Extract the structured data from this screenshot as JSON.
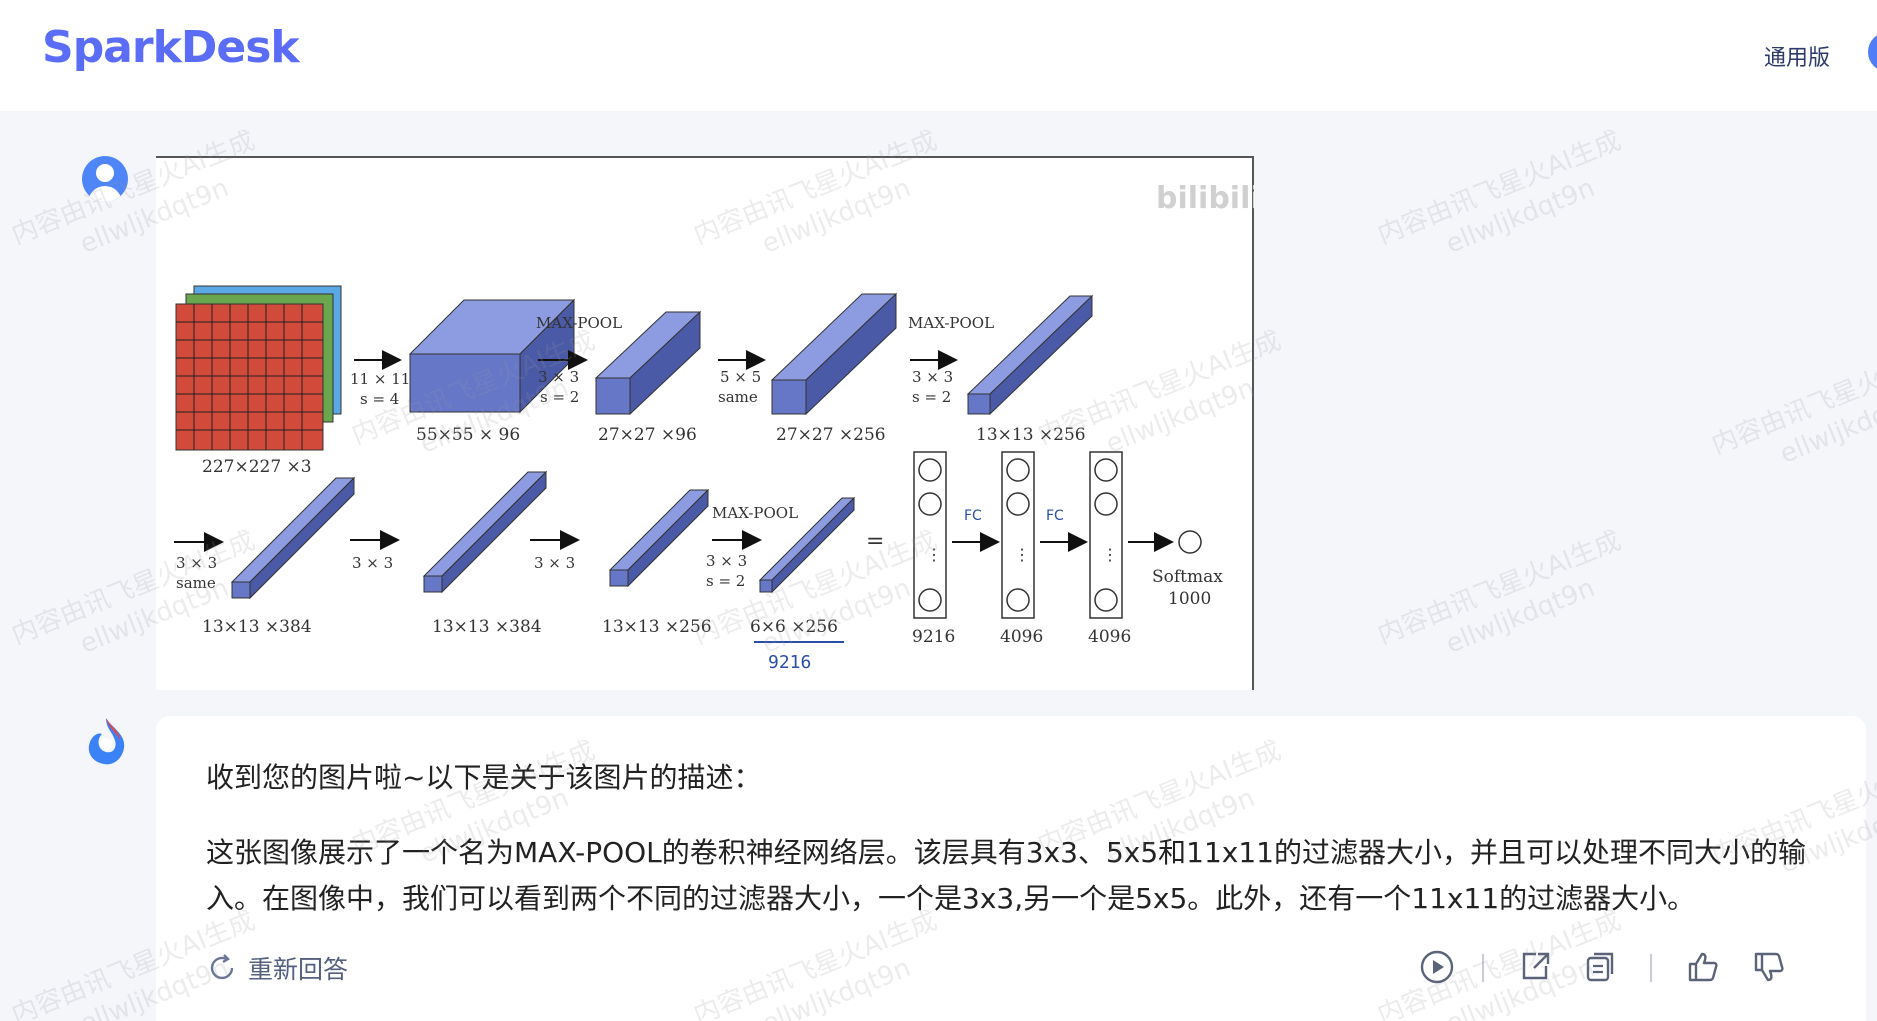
{
  "header": {
    "logo": "SparkDesk",
    "edition": "通用版"
  },
  "user_message": {
    "image": {
      "site_mark": "bilibili",
      "row1": {
        "input_label": "227×227 ×3",
        "conv1_filter": "11 × 11",
        "conv1_stride": "s = 4",
        "vol1": "55×55 × 96",
        "pool1_title": "MAX-POOL",
        "pool1_filter": "3 × 3",
        "pool1_stride": "s = 2",
        "vol2": "27×27 ×96",
        "conv2_filter": "5 × 5",
        "conv2_pad": "same",
        "vol3": "27×27 ×256",
        "pool2_title": "MAX-POOL",
        "pool2_filter": "3 × 3",
        "pool2_stride": "s = 2",
        "vol4": "13×13 ×256"
      },
      "row2": {
        "conv3_filter": "3 × 3",
        "conv3_pad": "same",
        "vol5": "13×13 ×384",
        "conv4_filter": "3 × 3",
        "vol6": "13×13 ×384",
        "conv5_filter": "3 × 3",
        "vol7": "13×13 ×256",
        "pool3_title": "MAX-POOL",
        "pool3_filter": "3 × 3",
        "pool3_stride": "s = 2",
        "vol8": "6×6 ×256",
        "flatten_note": "9216",
        "equals": "=",
        "fc_layers": [
          "9216",
          "4096",
          "4096"
        ],
        "fc_note_1": "FC",
        "fc_note_2": "FC",
        "dots": "⋮",
        "softmax": "Softmax",
        "softmax_units": "1000"
      }
    }
  },
  "bot_message": {
    "intro": "收到您的图片啦~以下是关于该图片的描述：",
    "body": "这张图像展示了一个名为MAX-POOL的卷积神经网络层。该层具有3x3、5x5和11x11的过滤器大小，并且可以处理不同大小的输入。在图像中，我们可以看到两个不同的过滤器大小，一个是3x3,另一个是5x5。此外，还有一个11x11的过滤器大小。",
    "regenerate": "重新回答",
    "toolbar_icons": [
      "play-icon",
      "share-icon",
      "copy-icon",
      "thumbs-up-icon",
      "thumbs-down-icon"
    ]
  },
  "watermark": {
    "line1": "内容由讯飞星火AI生成",
    "line2": "ellwljkdqt9n"
  },
  "colors": {
    "brand": "#5b6cf6",
    "block_front": "#6677c8",
    "block_top": "#8d9ce0",
    "block_side": "#4a5aa6",
    "input_red": "#d24a3a",
    "input_green": "#6aa64e",
    "input_blue": "#5aa8e6"
  }
}
